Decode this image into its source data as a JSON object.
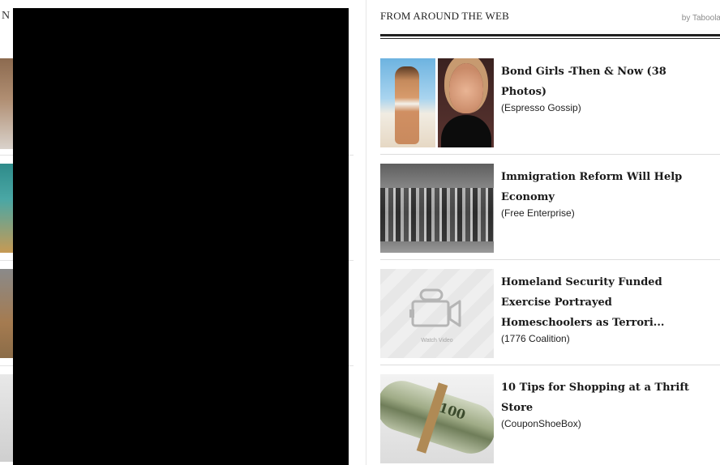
{
  "left_column": {
    "initial": "N"
  },
  "widget": {
    "title": "FROM AROUND THE WEB",
    "attribution": "by Taboola",
    "items": [
      {
        "title": "Bond Girls -Then & Now (38 Photos)",
        "source": "(Espresso Gossip)"
      },
      {
        "title": "Immigration Reform Will Help Economy",
        "source": "(Free Enterprise)"
      },
      {
        "title": "Homeland Security Funded Exercise Portrayed Homeschoolers as Terrori...",
        "source": "(1776 Coalition)",
        "thumb_label": "Watch Video",
        "thumb_icon": "video-camera-icon"
      },
      {
        "title": "10 Tips for Shopping at a Thrift Store",
        "source": "(CouponShoeBox)",
        "thumb_text": "100"
      }
    ]
  }
}
